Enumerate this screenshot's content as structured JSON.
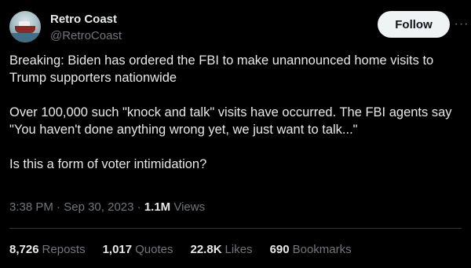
{
  "author": {
    "display_name": "Retro Coast",
    "handle": "@RetroCoast",
    "avatar_icon": "ship-avatar"
  },
  "actions": {
    "follow_label": "Follow",
    "more_label": "···"
  },
  "tweet": {
    "paragraphs": [
      "Breaking: Biden has ordered the FBI to make unannounced home visits to Trump supporters nationwide",
      "Over 100,000 such \"knock and talk\" visits have occurred. The FBI agents say \"You haven't done anything wrong yet, we just want to talk...\"",
      "Is this a form of voter intimidation?"
    ]
  },
  "meta": {
    "time": "3:38 PM",
    "separator": "·",
    "date": "Sep 30, 2023",
    "views_count": "1.1M",
    "views_label": "Views"
  },
  "stats": [
    {
      "count": "8,726",
      "label": "Reposts"
    },
    {
      "count": "1,017",
      "label": "Quotes"
    },
    {
      "count": "22.8K",
      "label": "Likes"
    },
    {
      "count": "690",
      "label": "Bookmarks"
    }
  ],
  "colors": {
    "background": "#000000",
    "text_primary": "#e7e9ea",
    "text_secondary": "#71767b",
    "follow_button_bg": "#eff3f4",
    "divider": "#2f3336"
  }
}
